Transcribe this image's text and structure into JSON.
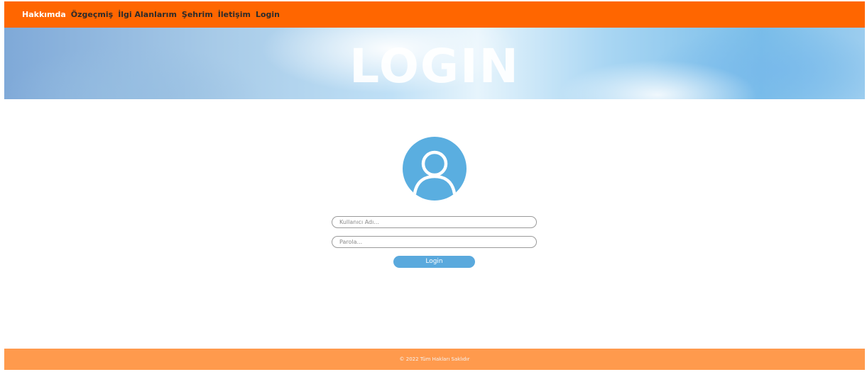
{
  "nav": {
    "items": [
      {
        "label": "Hakkımda",
        "active": true
      },
      {
        "label": "Özgeçmiş",
        "active": false
      },
      {
        "label": "İlgi Alanlarım",
        "active": false
      },
      {
        "label": "Şehrim",
        "active": false
      },
      {
        "label": "İletişim",
        "active": false
      },
      {
        "label": "Login",
        "active": false
      }
    ]
  },
  "hero": {
    "title": "LOGIN"
  },
  "avatar": {
    "icon": "user-icon"
  },
  "form": {
    "username": {
      "placeholder": "Kullanıcı Adı...",
      "value": ""
    },
    "password": {
      "placeholder": "Parola...",
      "value": ""
    },
    "submit_label": "Login"
  },
  "footer": {
    "text": "© 2022 Tüm Hakları Saklıdır"
  },
  "colors": {
    "nav_bg": "#ff6600",
    "footer_bg": "#ff9a4d",
    "accent_blue": "#5aa9dd",
    "active_nav_text": "#ffffff"
  }
}
